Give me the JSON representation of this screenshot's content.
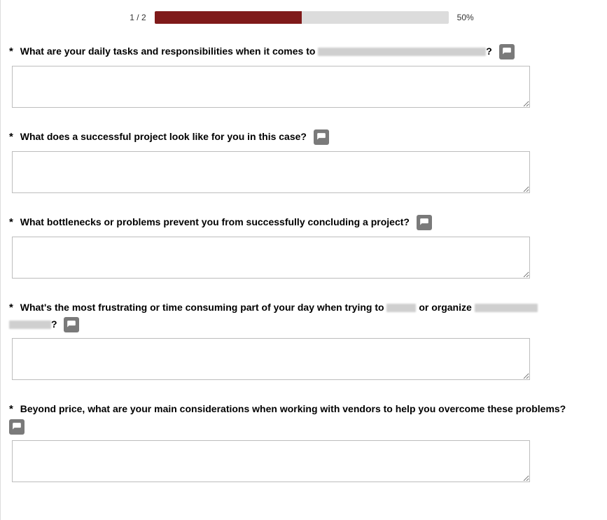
{
  "progress": {
    "step_label": "1 / 2",
    "percent_label": "50%",
    "percent_value": 50
  },
  "required_mark": "*",
  "questions": [
    {
      "id": "q1",
      "text_before": "What are your daily tasks and responsibilities when it comes to ",
      "redacted1_w": 240,
      "text_after": "?",
      "show_comment": true,
      "value": ""
    },
    {
      "id": "q2",
      "text_before": "What does a successful project look like for you in this case?",
      "text_after": "",
      "show_comment": true,
      "value": ""
    },
    {
      "id": "q3",
      "text_before": "What bottlenecks or problems prevent you from successfully concluding a project?",
      "text_after": "",
      "show_comment": true,
      "value": ""
    },
    {
      "id": "q4",
      "text_before": "What's the most frustrating or time consuming part of your day when trying to ",
      "redacted1_w": 42,
      "text_mid": " or organize ",
      "redacted2_w": 90,
      "text_line2_redacted_w": 60,
      "text_after": "?",
      "show_comment": true,
      "value": ""
    },
    {
      "id": "q5",
      "text_before": "Beyond price, what are your main considerations when working with vendors to help you overcome these problems?",
      "text_after": "",
      "show_comment": true,
      "value": ""
    }
  ]
}
